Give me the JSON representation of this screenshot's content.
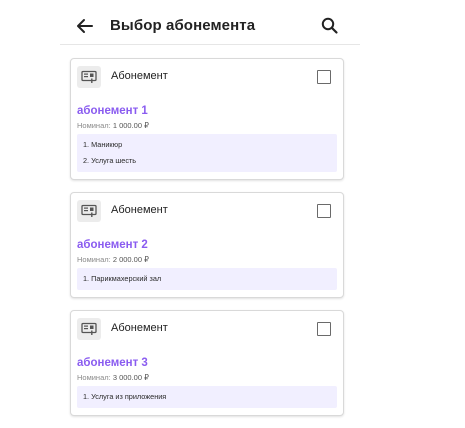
{
  "header": {
    "title": "Выбор абонемента",
    "back_icon": "arrow-left-icon",
    "search_icon": "search-icon"
  },
  "colors": {
    "accent": "#8a5cf0",
    "services_bg": "#f1efff",
    "card_border": "#d9d9d9"
  },
  "cards": [
    {
      "type_label": "Абонемент",
      "name": "абонемент 1",
      "nominal_label": "Номинал:",
      "nominal_value": "1 000.00 ₽",
      "checked": false,
      "services": [
        "1. Маникюр",
        "2. Услуга шесть"
      ]
    },
    {
      "type_label": "Абонемент",
      "name": "абонемент 2",
      "nominal_label": "Номинал:",
      "nominal_value": "2 000.00 ₽",
      "checked": false,
      "services": [
        "1. Парикмахерский зал"
      ]
    },
    {
      "type_label": "Абонемент",
      "name": "абонемент 3",
      "nominal_label": "Номинал:",
      "nominal_value": "3 000.00 ₽",
      "checked": false,
      "services": [
        "1. Услуга из приложения"
      ]
    }
  ]
}
